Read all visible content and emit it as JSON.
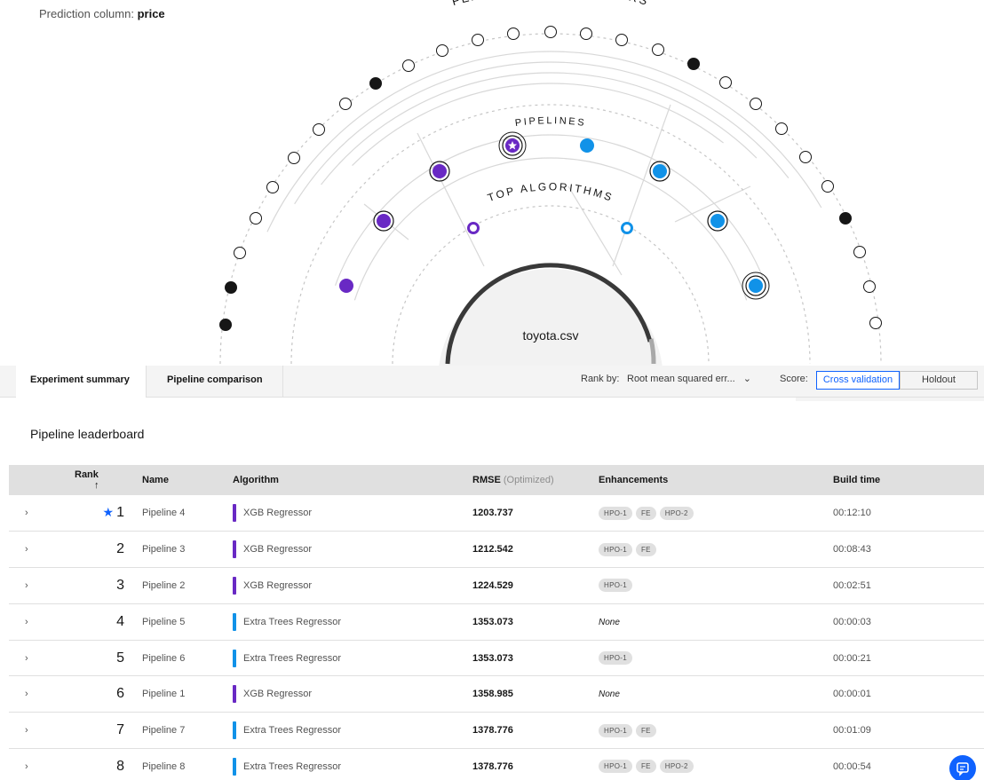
{
  "header": {
    "prediction_label": "Prediction column:",
    "prediction_value": "price"
  },
  "viz": {
    "ring_labels": {
      "outer": "FEATURE TRANSFORMERS",
      "middle": "PIPELINES",
      "inner": "TOP ALGORITHMS"
    },
    "center_label": "toyota.csv",
    "colors": {
      "xgb": "#6929c4",
      "extra_trees": "#1192e8",
      "filled": "#161616"
    }
  },
  "tabs": {
    "summary": "Experiment summary",
    "comparison": "Pipeline comparison"
  },
  "rank_by": {
    "label": "Rank by:",
    "value": "Root mean squared err...",
    "chevron": "chevron-down-icon"
  },
  "score": {
    "label": "Score:",
    "cv": "Cross validation",
    "holdout": "Holdout"
  },
  "leaderboard": {
    "title": "Pipeline leaderboard",
    "columns": {
      "rank": "Rank",
      "sort_arrow": "↑",
      "name": "Name",
      "algorithm": "Algorithm",
      "metric": "RMSE",
      "metric_note": "(Optimized)",
      "enhancements": "Enhancements",
      "build_time": "Build time"
    },
    "rows": [
      {
        "rank": "1",
        "star": "★",
        "name": "Pipeline 4",
        "algorithm": "XGB Regressor",
        "color": "#6929c4",
        "rmse": "1203.737",
        "enh": [
          "HPO-1",
          "FE",
          "HPO-2"
        ],
        "time": "00:12:10"
      },
      {
        "rank": "2",
        "star": "",
        "name": "Pipeline 3",
        "algorithm": "XGB Regressor",
        "color": "#6929c4",
        "rmse": "1212.542",
        "enh": [
          "HPO-1",
          "FE"
        ],
        "time": "00:08:43"
      },
      {
        "rank": "3",
        "star": "",
        "name": "Pipeline 2",
        "algorithm": "XGB Regressor",
        "color": "#6929c4",
        "rmse": "1224.529",
        "enh": [
          "HPO-1"
        ],
        "time": "00:02:51"
      },
      {
        "rank": "4",
        "star": "",
        "name": "Pipeline 5",
        "algorithm": "Extra Trees Regressor",
        "color": "#1192e8",
        "rmse": "1353.073",
        "enh": [],
        "none": "None",
        "time": "00:00:03"
      },
      {
        "rank": "5",
        "star": "",
        "name": "Pipeline 6",
        "algorithm": "Extra Trees Regressor",
        "color": "#1192e8",
        "rmse": "1353.073",
        "enh": [
          "HPO-1"
        ],
        "time": "00:00:21"
      },
      {
        "rank": "6",
        "star": "",
        "name": "Pipeline 1",
        "algorithm": "XGB Regressor",
        "color": "#6929c4",
        "rmse": "1358.985",
        "enh": [],
        "none": "None",
        "time": "00:00:01"
      },
      {
        "rank": "7",
        "star": "",
        "name": "Pipeline 7",
        "algorithm": "Extra Trees Regressor",
        "color": "#1192e8",
        "rmse": "1378.776",
        "enh": [
          "HPO-1",
          "FE"
        ],
        "time": "00:01:09"
      },
      {
        "rank": "8",
        "star": "",
        "name": "Pipeline 8",
        "algorithm": "Extra Trees Regressor",
        "color": "#1192e8",
        "rmse": "1378.776",
        "enh": [
          "HPO-1",
          "FE",
          "HPO-2"
        ],
        "time": "00:00:54"
      }
    ],
    "expand_icon": "chevron-right-icon"
  }
}
